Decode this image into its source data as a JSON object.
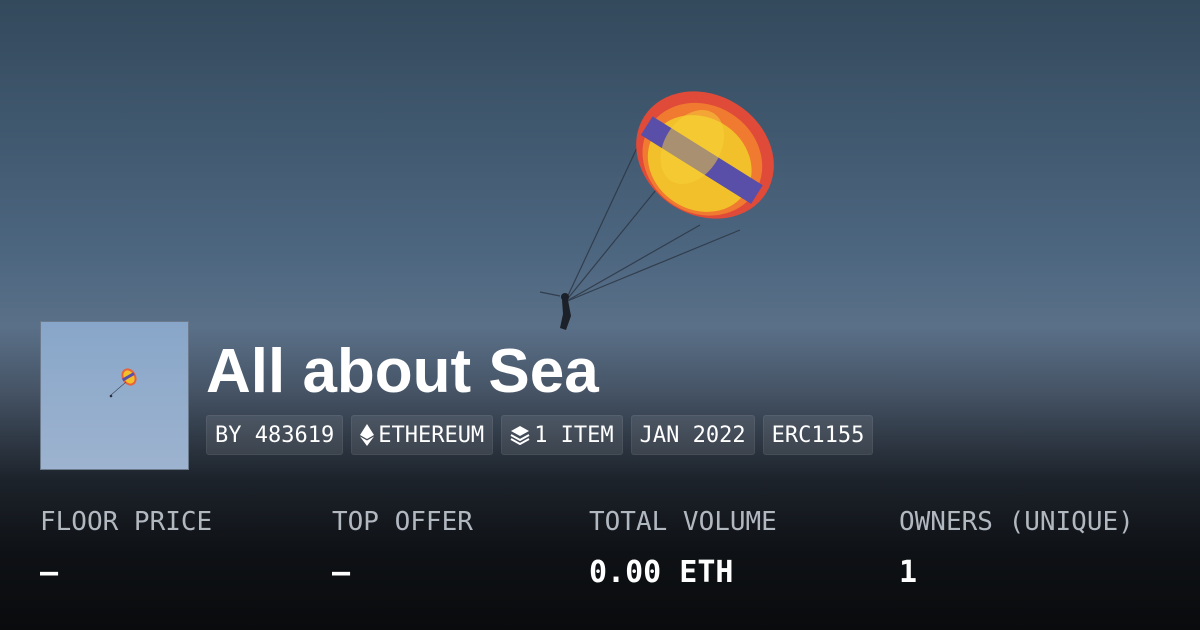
{
  "collection": {
    "name": "All about Sea",
    "creator": "BY 483619",
    "chain": "ETHEREUM",
    "item_count": "1 ITEM",
    "created": "JAN 2022",
    "standard": "ERC1155"
  },
  "icons": {
    "chain": "ethereum-icon",
    "items": "layers-icon"
  },
  "stats": [
    {
      "label": "FLOOR PRICE",
      "value": "–"
    },
    {
      "label": "TOP OFFER",
      "value": "–"
    },
    {
      "label": "TOTAL VOLUME",
      "value": "0.00 ETH"
    },
    {
      "label": "OWNERS (UNIQUE)",
      "value": "1"
    }
  ],
  "colors": {
    "sky": "#4d6680",
    "text": "#ffffff",
    "muted": "#b2b8c0",
    "canopy_red": "#e0503c",
    "canopy_yellow": "#f2c02a",
    "canopy_purple": "#5a4fa8"
  }
}
